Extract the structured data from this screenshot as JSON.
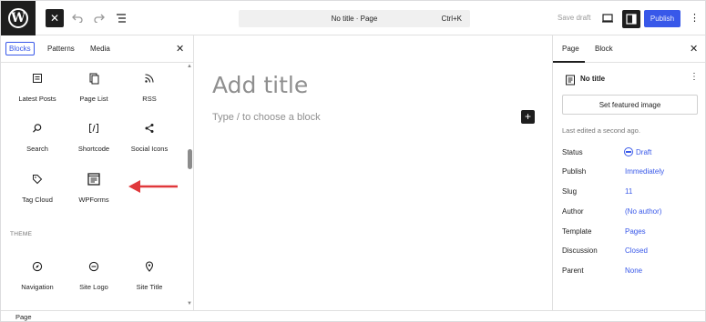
{
  "topbar": {
    "command_bar": "No title · Page",
    "command_shortcut": "Ctrl+K",
    "save_draft": "Save draft",
    "publish": "Publish"
  },
  "inserter": {
    "tabs": [
      "Blocks",
      "Patterns",
      "Media"
    ],
    "blocks": [
      {
        "label": "Latest Posts",
        "icon": "latest-posts-icon"
      },
      {
        "label": "Page List",
        "icon": "page-list-icon"
      },
      {
        "label": "RSS",
        "icon": "rss-icon"
      },
      {
        "label": "Search",
        "icon": "search-icon"
      },
      {
        "label": "Shortcode",
        "icon": "shortcode-icon"
      },
      {
        "label": "Social Icons",
        "icon": "share-icon"
      },
      {
        "label": "Tag Cloud",
        "icon": "tag-icon"
      },
      {
        "label": "WPForms",
        "icon": "wpforms-icon"
      }
    ],
    "theme_heading": "THEME",
    "theme_blocks": [
      {
        "label": "Navigation",
        "icon": "compass-icon"
      },
      {
        "label": "Site Logo",
        "icon": "site-logo-icon"
      },
      {
        "label": "Site Title",
        "icon": "map-pin-icon"
      }
    ]
  },
  "canvas": {
    "title_placeholder": "Add title",
    "block_placeholder": "Type / to choose a block"
  },
  "sidebar": {
    "tabs": [
      "Page",
      "Block"
    ],
    "doc_title": "No title",
    "featured_image": "Set featured image",
    "last_edited": "Last edited a second ago.",
    "rows": [
      {
        "label": "Status",
        "value": "Draft"
      },
      {
        "label": "Publish",
        "value": "Immediately"
      },
      {
        "label": "Slug",
        "value": "11"
      },
      {
        "label": "Author",
        "value": "(No author)"
      },
      {
        "label": "Template",
        "value": "Pages"
      },
      {
        "label": "Discussion",
        "value": "Closed"
      },
      {
        "label": "Parent",
        "value": "None"
      }
    ]
  },
  "footer": {
    "breadcrumb": "Page"
  },
  "colors": {
    "accent": "#3858e9",
    "dark": "#1e1e1e",
    "arrow": "#e0383b"
  }
}
